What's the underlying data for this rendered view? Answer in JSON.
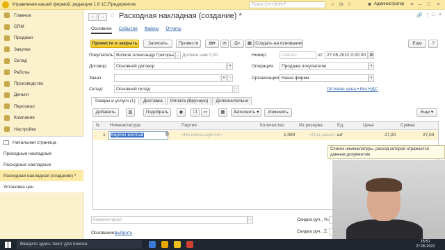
{
  "titlebar": {
    "app_title": "Управление нашей фирмой, редакция 1.6 1С:Предприятие",
    "search_placeholder": "Поиск Ctrl+Shift+F",
    "user": "Администратор"
  },
  "sidebar": {
    "items": [
      "Главное",
      "CRM",
      "Продажи",
      "Закупки",
      "Склад",
      "Работы",
      "Производство",
      "Деньги",
      "Персонал",
      "Компания",
      "Настройки"
    ]
  },
  "open_windows": {
    "items": [
      "Начальная страница",
      "Приходные накладные",
      "Расходные накладные",
      "Расходная накладная (создание) *",
      "Установка цен"
    ]
  },
  "form": {
    "title": "Расходная накладная (создание) *",
    "tabs": [
      "Основное",
      "События",
      "Файлы",
      "Отчеты"
    ],
    "toolbar": {
      "post_close": "Провести и закрыть",
      "save": "Записать",
      "post": "Провести",
      "create_based": "Создать на основании",
      "more": "Еще"
    },
    "fields": {
      "buyer_label": "Покупатель:",
      "buyer_value": "Волков Александр Григорьевич",
      "owes_label": "Должен нам 0,00",
      "number_label": "Номер:",
      "number_placeholder": "<Авто>",
      "date_from": "от:",
      "date_value": "27.05.2022  0:00:00",
      "contract_label": "Договор:",
      "contract_value": "Основной договор",
      "operation_label": "Операция:",
      "operation_value": "Продажа покупателю",
      "order_label": "Заказ:",
      "org_label": "Организация:",
      "org_value": "Наша фирма",
      "warehouse_label": "Склад:",
      "warehouse_value": "Основной склад",
      "price_link": "Оптовая цена • без НДС"
    },
    "page_tabs": [
      "Товары и услуги (1)",
      "Доставка",
      "Оплата (Вручную)",
      "Дополнительно"
    ],
    "grid_toolbar": {
      "add": "Добавить",
      "pick": "Подобрать",
      "fill": "Заполнить",
      "change": "Изменить",
      "more": "Еще"
    },
    "grid": {
      "columns": [
        "N",
        "Номенклатура",
        "Партия",
        "Количество",
        "Из резерва",
        "Ед.",
        "Цена",
        "Сумма"
      ],
      "rows": [
        {
          "n": "1",
          "item": "Кирпич желтый",
          "batch": "<Не используется>",
          "qty": "1,000",
          "reserve": "<Под заказ>",
          "unit": "шт",
          "price": "27,00",
          "sum": "27,00"
        }
      ]
    },
    "tooltip": "Список номенклатуры, расход которой отражается данным документом",
    "footer": {
      "comment_placeholder": "Комментарий",
      "discount_pct_label": "Скидка руч., %:",
      "discount_sum_label": "Скидка руч., Σ:",
      "responsible_label": "Основание:",
      "responsible_link": "выбрать"
    }
  },
  "taskbar": {
    "search": "Введите здесь текст для поиска",
    "time": "15:51",
    "date": "27.05.2022"
  }
}
